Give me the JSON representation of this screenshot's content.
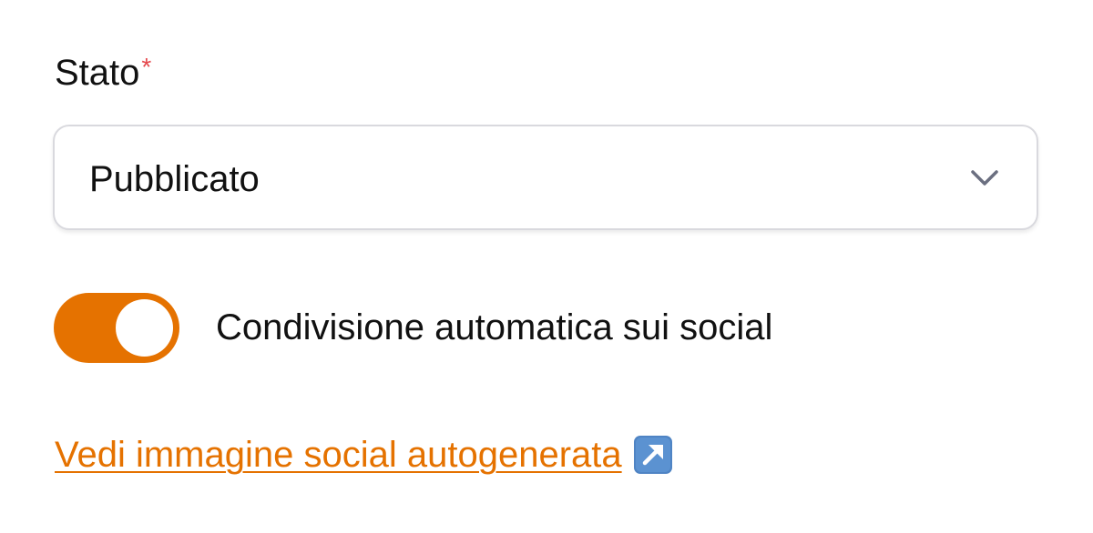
{
  "status_field": {
    "label": "Stato",
    "required_mark": "*",
    "selected_value": "Pubblicato",
    "dropdown_icon": "chevron-down-icon"
  },
  "auto_share": {
    "enabled": true,
    "label": "Condivisione automatica sui social"
  },
  "social_image_link": {
    "label": "Vedi immagine social autogenerata",
    "icon": "external-link-icon"
  },
  "colors": {
    "accent": "#e57200",
    "required": "#e5484d",
    "chevron": "#6b6f80",
    "icon_bg": "#4f84c4"
  }
}
